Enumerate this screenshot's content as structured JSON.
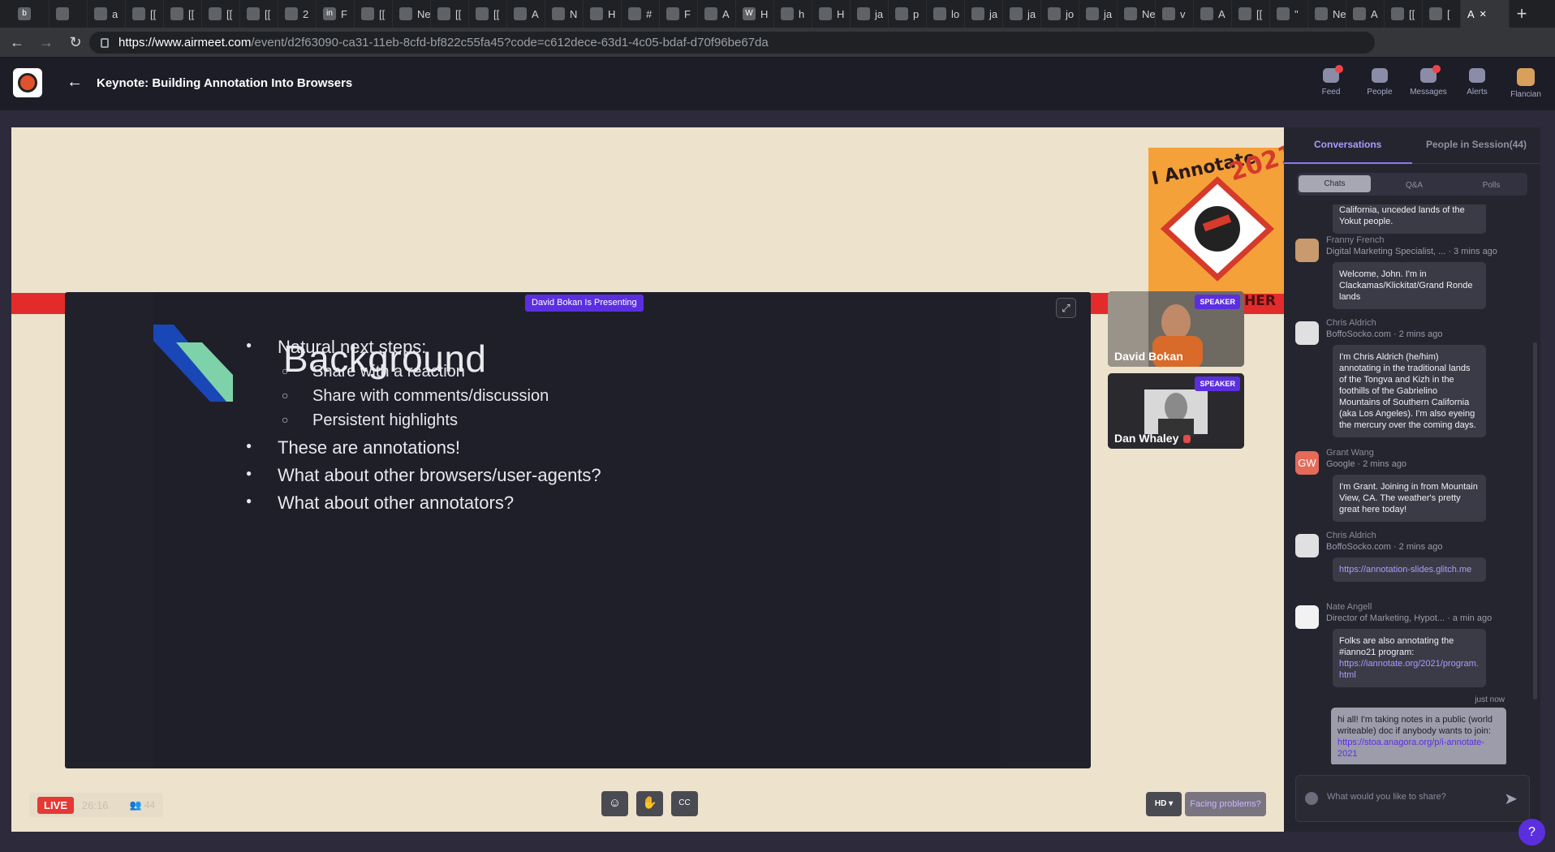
{
  "browser": {
    "tabs": [
      {
        "icon": "b",
        "label": ""
      },
      {
        "icon": "",
        "label": ""
      },
      {
        "icon": "",
        "label": "a"
      },
      {
        "icon": "",
        "label": "[["
      },
      {
        "icon": "",
        "label": "[["
      },
      {
        "icon": "",
        "label": "[["
      },
      {
        "icon": "",
        "label": "[["
      },
      {
        "icon": "",
        "label": "2"
      },
      {
        "icon": "in",
        "label": "F"
      },
      {
        "icon": "",
        "label": "[["
      },
      {
        "icon": "",
        "label": "New"
      },
      {
        "icon": "",
        "label": "[["
      },
      {
        "icon": "",
        "label": "[["
      },
      {
        "icon": "",
        "label": "A"
      },
      {
        "icon": "",
        "label": "N"
      },
      {
        "icon": "",
        "label": "H"
      },
      {
        "icon": "",
        "label": "#"
      },
      {
        "icon": "",
        "label": "F"
      },
      {
        "icon": "",
        "label": "A"
      },
      {
        "icon": "W",
        "label": "H"
      },
      {
        "icon": "",
        "label": "h"
      },
      {
        "icon": "",
        "label": "H"
      },
      {
        "icon": "",
        "label": "ja"
      },
      {
        "icon": "",
        "label": "p"
      },
      {
        "icon": "",
        "label": "lo"
      },
      {
        "icon": "",
        "label": "ja"
      },
      {
        "icon": "",
        "label": "ja"
      },
      {
        "icon": "",
        "label": "jo"
      },
      {
        "icon": "",
        "label": "ja"
      },
      {
        "icon": "",
        "label": "New"
      },
      {
        "icon": "",
        "label": "v"
      },
      {
        "icon": "",
        "label": "A"
      },
      {
        "icon": "",
        "label": "[["
      },
      {
        "icon": "",
        "label": "\""
      },
      {
        "icon": "",
        "label": "New"
      },
      {
        "icon": "",
        "label": "A"
      },
      {
        "icon": "",
        "label": "[["
      },
      {
        "icon": "",
        "label": "["
      }
    ],
    "active_tab": {
      "label": "A"
    },
    "url_host": "https://www.airmeet.com",
    "url_path": "/event/d2f63090-ca31-11eb-8cfd-bf822c55fa45?code=c612dece-63d1-4c05-bdaf-d70f96be67da"
  },
  "header": {
    "title": "Keynote: Building Annotation Into Browsers",
    "nav": [
      {
        "label": "Feed",
        "icon": "feed-icon",
        "badge": true
      },
      {
        "label": "People",
        "icon": "people-icon",
        "badge": false
      },
      {
        "label": "Messages",
        "icon": "messages-icon",
        "badge": true
      },
      {
        "label": "Alerts",
        "icon": "bell-icon",
        "badge": false
      },
      {
        "label": "Flancian",
        "icon": "avatar",
        "badge": false
      }
    ]
  },
  "banner": {
    "logo_text_1": "I Annotate",
    "logo_text_2": "2021",
    "stripe_text": "GETHER"
  },
  "slide": {
    "presenting": "David Bokan Is Presenting",
    "title": "Background",
    "bullets": [
      {
        "level": 1,
        "text": "Natural next steps:"
      },
      {
        "level": 2,
        "text": "Share with a reaction"
      },
      {
        "level": 2,
        "text": "Share with comments/discussion"
      },
      {
        "level": 2,
        "text": "Persistent highlights"
      },
      {
        "level": 1,
        "text": "These are annotations!"
      },
      {
        "level": 1,
        "text": "What about other browsers/user-agents?"
      },
      {
        "level": 1,
        "text": "What about other annotators?"
      }
    ]
  },
  "speakers": [
    {
      "name": "David Bokan",
      "badge": "SPEAKER"
    },
    {
      "name": "Dan Whaley",
      "badge": "SPEAKER"
    }
  ],
  "controls": {
    "live": "LIVE",
    "timer": "26:16",
    "viewers": "44",
    "hd": "HD",
    "facing": "Facing problems?"
  },
  "panel": {
    "tab_conversations": "Conversations",
    "tab_people": "People in Session(44)",
    "subtabs": [
      "Chats",
      "Q&A",
      "Polls"
    ],
    "messages": [
      {
        "name": "",
        "meta": "",
        "text": "California, unceded lands of the Yokut people."
      },
      {
        "name": "Franny French",
        "meta": "Digital Marketing Specialist, ... · 3 mins ago",
        "text": "Welcome, John. I'm in Clackamas/Klickitat/Grand Ronde lands"
      },
      {
        "name": "Chris Aldrich",
        "meta": "BoffoSocko.com · 2 mins ago",
        "text": "I'm Chris Aldrich (he/him) annotating in the traditional lands of the Tongva and Kizh in the foothills of the Gabrielino Mountains of Southern California (aka Los Angeles). I'm also eyeing the mercury over the coming days."
      },
      {
        "name": "Grant Wang",
        "meta": "Google · 2 mins ago",
        "initials": "GW",
        "text": "I'm Grant. Joining in from Mountain View, CA. The weather's pretty great here today!"
      },
      {
        "name": "Chris Aldrich",
        "meta": "BoffoSocko.com · 2 mins ago",
        "text": "https://annotation-slides.glitch.me"
      },
      {
        "name": "Nate Angell",
        "meta": "Director of Marketing, Hypot... · a min ago",
        "text": "Folks are also annotating the #ianno21 program:",
        "link": "https://iannotate.org/2021/program.html"
      }
    ],
    "own_time": "just now",
    "own_text": "hi all! I'm taking notes in a public (world writeable) doc if anybody wants to join:",
    "own_link": "https://stoa.anagora.org/p/i-annotate-2021",
    "input_placeholder": "What would you like to share?"
  },
  "colors": {
    "accent": "#5b2fe0",
    "live": "#e53935",
    "stage": "#ede2cc",
    "stripe": "#e32b2b"
  }
}
